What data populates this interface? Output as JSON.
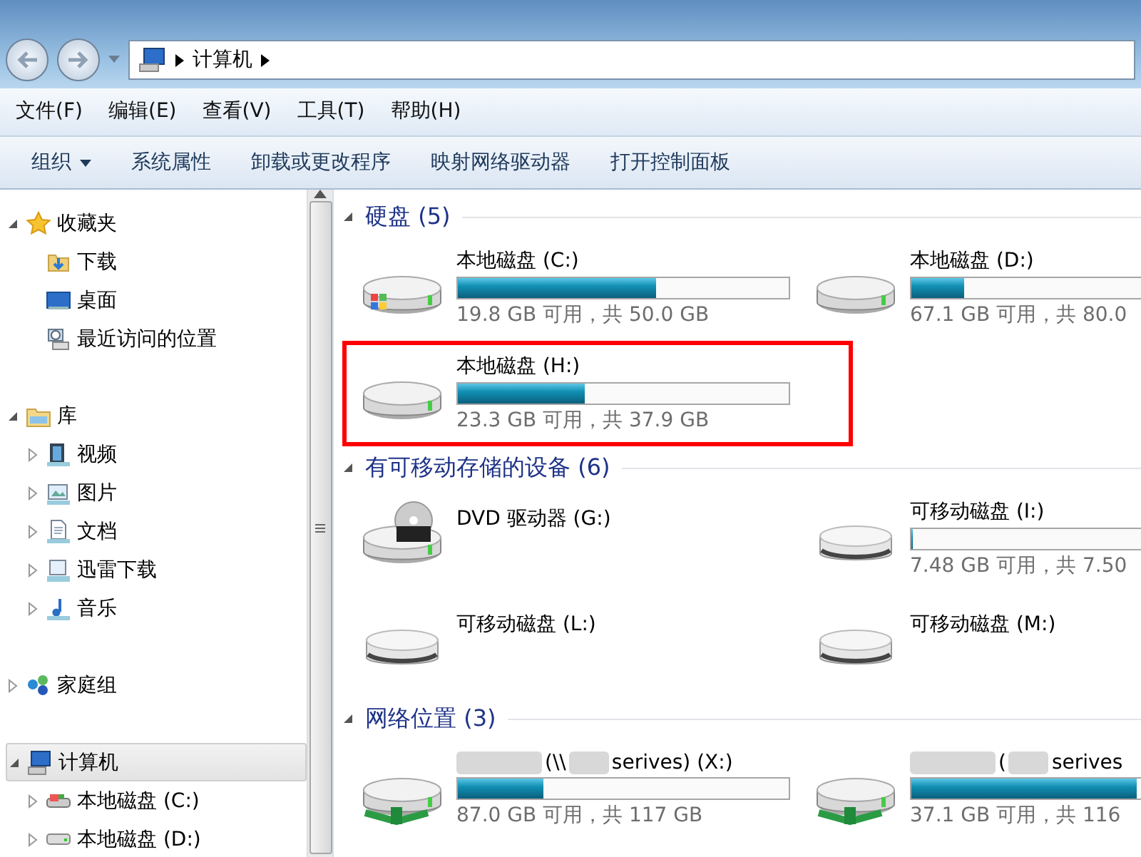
{
  "address_bar": {
    "segments": [
      "计算机"
    ]
  },
  "menu_bar": [
    "文件(F)",
    "编辑(E)",
    "查看(V)",
    "工具(T)",
    "帮助(H)"
  ],
  "toolbar": [
    {
      "label": "组织",
      "dropdown": true
    },
    {
      "label": "系统属性",
      "dropdown": false
    },
    {
      "label": "卸载或更改程序",
      "dropdown": false
    },
    {
      "label": "映射网络驱动器",
      "dropdown": false
    },
    {
      "label": "打开控制面板",
      "dropdown": false
    }
  ],
  "nav_pane": [
    {
      "label": "收藏夹",
      "kind": "star",
      "expanded": true,
      "selected": false,
      "children": [
        {
          "label": "下载",
          "kind": "download",
          "selected": false
        },
        {
          "label": "桌面",
          "kind": "desktop",
          "selected": false
        },
        {
          "label": "最近访问的位置",
          "kind": "recent",
          "selected": false
        }
      ]
    },
    {
      "label": "库",
      "kind": "library",
      "expanded": true,
      "selected": false,
      "children": [
        {
          "label": "视频",
          "kind": "video",
          "expanded": false,
          "selected": false
        },
        {
          "label": "图片",
          "kind": "picture",
          "expanded": false,
          "selected": false
        },
        {
          "label": "文档",
          "kind": "document",
          "expanded": false,
          "selected": false
        },
        {
          "label": "迅雷下载",
          "kind": "folder",
          "expanded": false,
          "selected": false
        },
        {
          "label": "音乐",
          "kind": "music",
          "expanded": false,
          "selected": false
        }
      ]
    },
    {
      "label": "家庭组",
      "kind": "homegroup",
      "expanded": false,
      "selected": false
    },
    {
      "label": "计算机",
      "kind": "computer",
      "expanded": true,
      "selected": true,
      "children": [
        {
          "label": "本地磁盘 (C:)",
          "kind": "system-drive",
          "expanded": false,
          "selected": false
        },
        {
          "label": "本地磁盘 (D:)",
          "kind": "hdd",
          "expanded": false,
          "selected": false
        }
      ]
    }
  ],
  "sections": [
    {
      "title": "硬盘 (5)",
      "expanded": true,
      "items": [
        {
          "name": "本地磁盘 (C:)",
          "kind": "system-drive",
          "level": 0.6,
          "space": "19.8 GB 可用，共 50.0 GB",
          "highlighted": false
        },
        {
          "name": "本地磁盘 (D:)",
          "kind": "hdd",
          "level": 0.16,
          "space": "67.1 GB 可用，共 80.0",
          "highlighted": false
        },
        {
          "name": "本地磁盘 (H:)",
          "kind": "hdd",
          "level": 0.385,
          "space": "23.3 GB 可用，共 37.9 GB",
          "highlighted": true
        }
      ]
    },
    {
      "title": "有可移动存储的设备 (6)",
      "expanded": true,
      "items": [
        {
          "name": "DVD 驱动器 (G:)",
          "kind": "dvd",
          "highlighted": false
        },
        {
          "name": "可移动磁盘 (I:)",
          "kind": "usb",
          "level": 0.003,
          "space": "7.48 GB 可用，共 7.50",
          "highlighted": false
        },
        {
          "name": "可移动磁盘 (L:)",
          "kind": "usb",
          "highlighted": false
        },
        {
          "name": "可移动磁盘 (M:)",
          "kind": "usb",
          "highlighted": false
        }
      ]
    },
    {
      "title": "网络位置 (3)",
      "expanded": true,
      "items": [
        {
          "name_parts": [
            "(\\\\",
            "serives) (X:)"
          ],
          "kind": "network",
          "level": 0.26,
          "space": "87.0 GB 可用，共 117 GB",
          "highlighted": false
        },
        {
          "name_parts": [
            "(",
            "serives"
          ],
          "kind": "network",
          "level": 0.68,
          "space": "37.1 GB 可用，共 116",
          "highlighted": false
        }
      ]
    }
  ]
}
